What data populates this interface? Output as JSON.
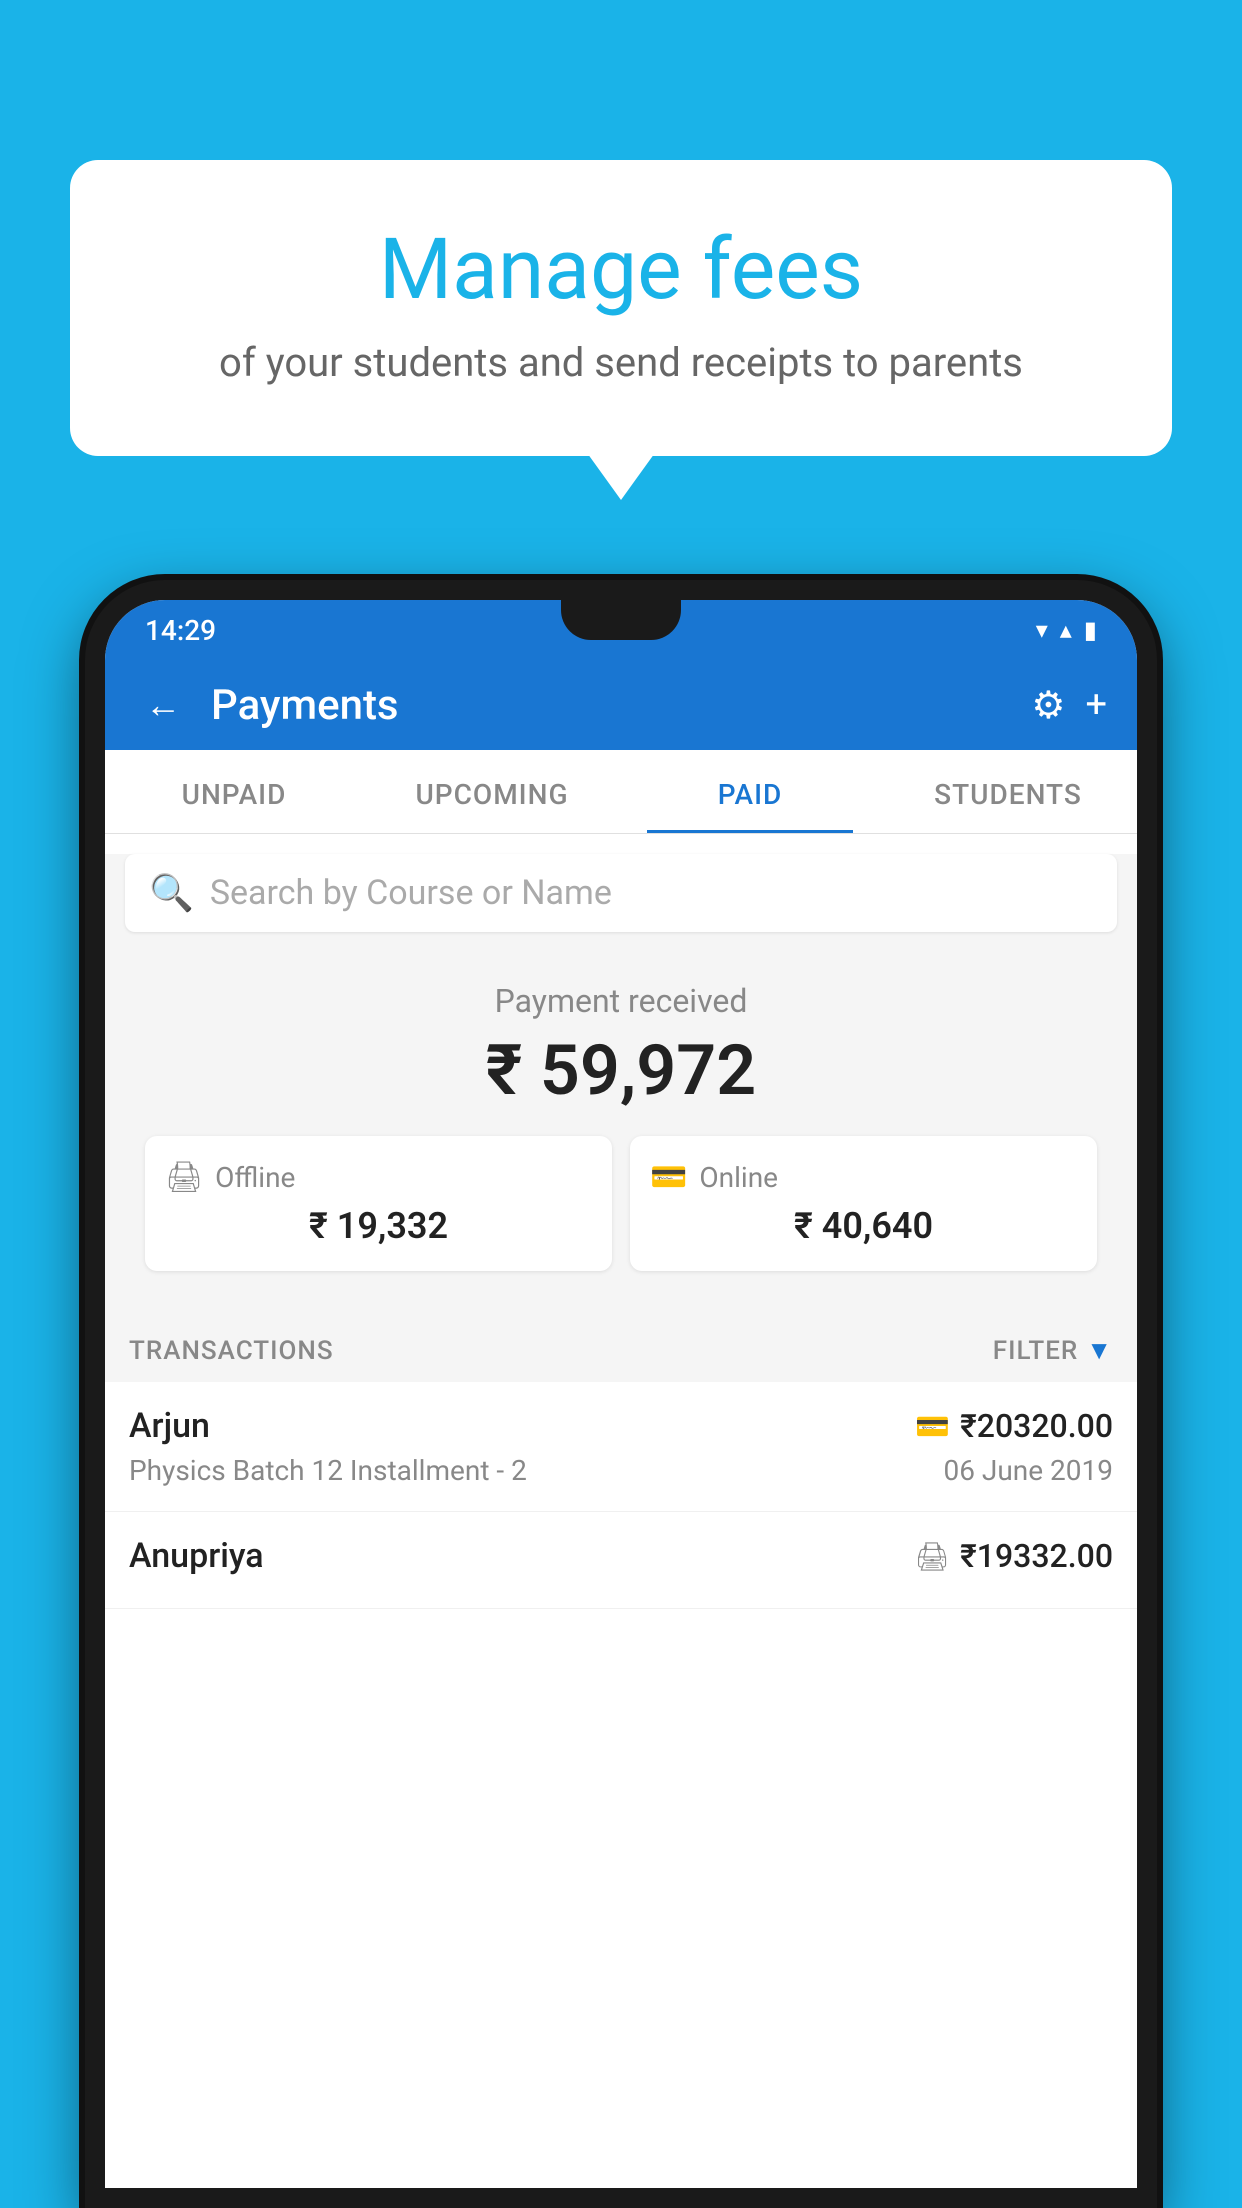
{
  "background_color": "#1ab3e8",
  "speech_bubble": {
    "title": "Manage fees",
    "subtitle": "of your students and send receipts to parents"
  },
  "status_bar": {
    "time": "14:29",
    "wifi_icon": "▾",
    "signal_icon": "▴",
    "battery_icon": "▮"
  },
  "header": {
    "title": "Payments",
    "back_label": "←",
    "settings_label": "⚙",
    "add_label": "+"
  },
  "tabs": [
    {
      "label": "UNPAID",
      "active": false
    },
    {
      "label": "UPCOMING",
      "active": false
    },
    {
      "label": "PAID",
      "active": true
    },
    {
      "label": "STUDENTS",
      "active": false
    }
  ],
  "search": {
    "placeholder": "Search by Course or Name"
  },
  "payment_received": {
    "label": "Payment received",
    "amount": "₹ 59,972"
  },
  "payment_cards": [
    {
      "icon": "₹",
      "label": "Offline",
      "amount": "₹ 19,332"
    },
    {
      "icon": "▬",
      "label": "Online",
      "amount": "₹ 40,640"
    }
  ],
  "transactions": {
    "label": "TRANSACTIONS",
    "filter_label": "FILTER",
    "items": [
      {
        "name": "Arjun",
        "amount_icon": "▬",
        "amount": "₹20320.00",
        "detail": "Physics Batch 12 Installment - 2",
        "date": "06 June 2019"
      },
      {
        "name": "Anupriya",
        "amount_icon": "₹",
        "amount": "₹19332.00",
        "detail": "",
        "date": ""
      }
    ]
  }
}
